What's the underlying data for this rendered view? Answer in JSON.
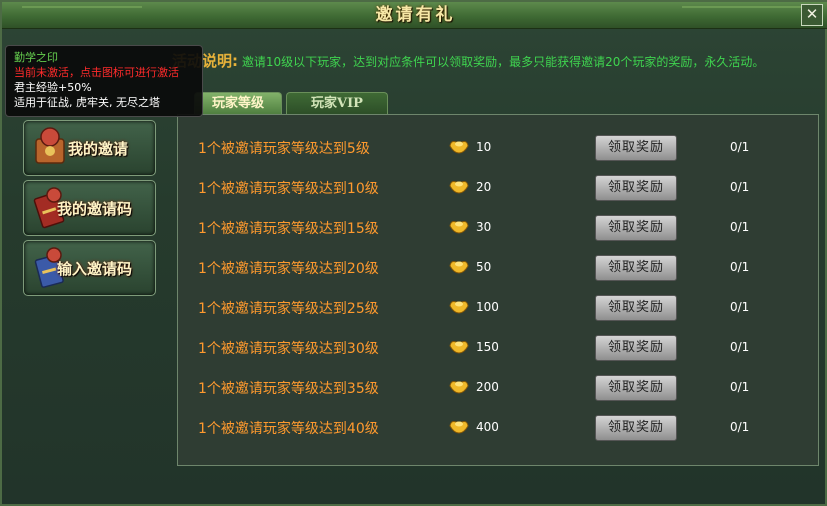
{
  "window": {
    "title": "邀请有礼",
    "close_glyph": "✕"
  },
  "description": {
    "label": "活动说明:",
    "text": "邀请10级以下玩家，达到对应条件可以领取奖励，最多只能获得邀请20个玩家的奖励，永久活动。"
  },
  "tabs": [
    {
      "label": "玩家等级",
      "active": true
    },
    {
      "label": "玩家VIP",
      "active": false
    }
  ],
  "sidebar": [
    {
      "label": "我的邀请",
      "icon": "invite-scroll-icon"
    },
    {
      "label": "我的邀请码",
      "icon": "invite-code-icon"
    },
    {
      "label": "输入邀请码",
      "icon": "input-code-icon"
    }
  ],
  "tooltip": {
    "title": "勤学之印",
    "status": "当前未激活，点击图标可进行激活",
    "effect": "君主经验+50%",
    "scope": "适用于征战, 虎牢关, 无尽之塔"
  },
  "reward_button_label": "领取奖励",
  "rewards": [
    {
      "condition": "1个被邀请玩家等级达到5级",
      "amount": "10",
      "progress": "0/1"
    },
    {
      "condition": "1个被邀请玩家等级达到10级",
      "amount": "20",
      "progress": "0/1"
    },
    {
      "condition": "1个被邀请玩家等级达到15级",
      "amount": "30",
      "progress": "0/1"
    },
    {
      "condition": "1个被邀请玩家等级达到20级",
      "amount": "50",
      "progress": "0/1"
    },
    {
      "condition": "1个被邀请玩家等级达到25级",
      "amount": "100",
      "progress": "0/1"
    },
    {
      "condition": "1个被邀请玩家等级达到30级",
      "amount": "150",
      "progress": "0/1"
    },
    {
      "condition": "1个被邀请玩家等级达到35级",
      "amount": "200",
      "progress": "0/1"
    },
    {
      "condition": "1个被邀请玩家等级达到40级",
      "amount": "400",
      "progress": "0/1"
    }
  ],
  "colors": {
    "condition": "#ff9a2e",
    "description": "#3fd44f",
    "title": "#f6e7a6"
  }
}
